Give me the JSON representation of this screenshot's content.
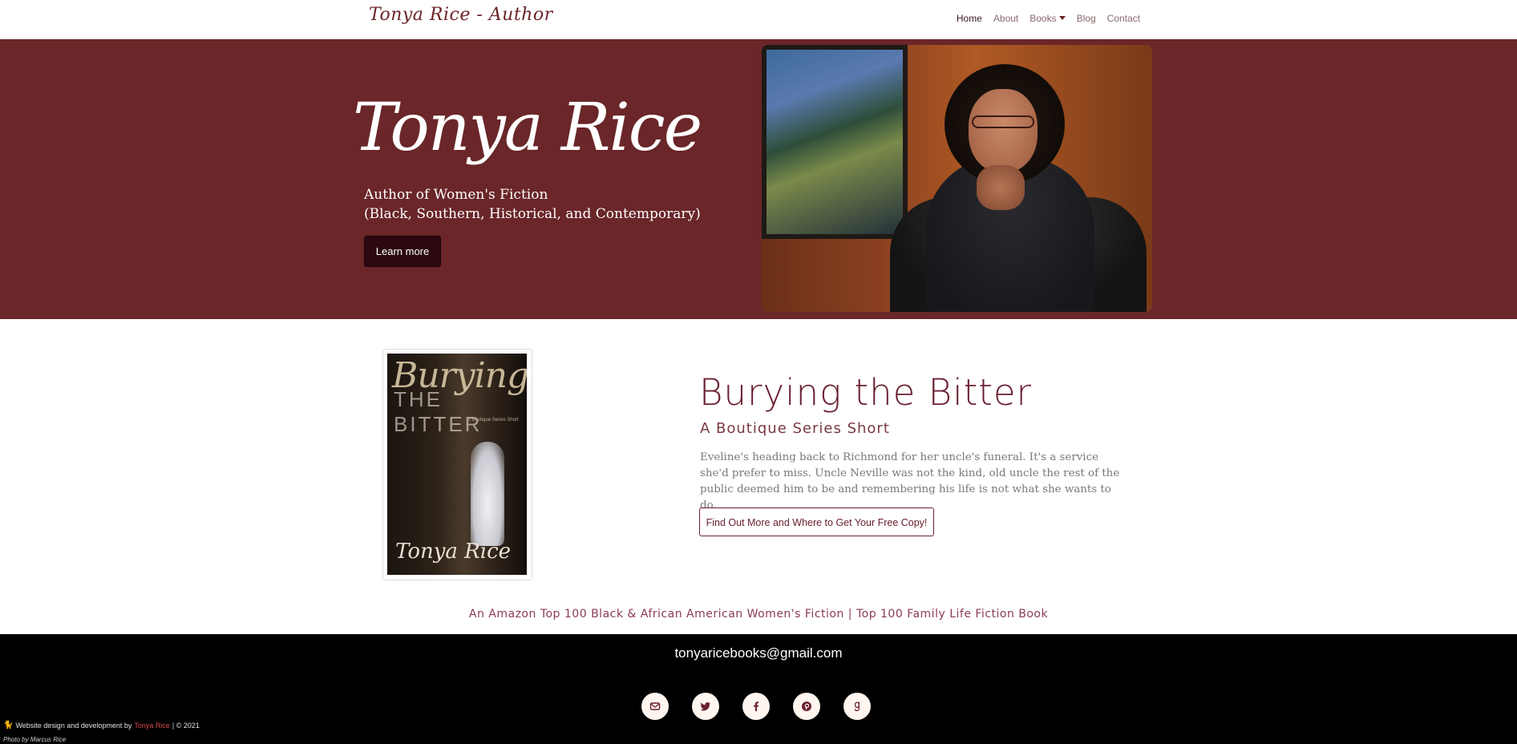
{
  "nav": {
    "brand": "Tonya Rice - Author",
    "items": [
      {
        "label": "Home",
        "active": true
      },
      {
        "label": "About"
      },
      {
        "label": "Books",
        "dropdown": true
      },
      {
        "label": "Blog"
      },
      {
        "label": "Contact"
      }
    ]
  },
  "hero": {
    "title": "Tonya Rice",
    "subtitle_line1": "Author of Women's Fiction",
    "subtitle_line2": "(Black, Southern, Historical, and Contemporary)",
    "button_label": "Learn more"
  },
  "featured_book": {
    "cover_title": "Burying",
    "cover_subtitle": "THE BITTER",
    "cover_tagline": "A Boutique Series Short",
    "cover_author": "Tonya Rice",
    "title": "Burying the Bitter",
    "subtitle": "A Boutique Series Short",
    "description": "Eveline's heading back to Richmond for her uncle's funeral. It's a service she'd prefer to miss. Uncle Neville was not the kind, old uncle the rest of the public deemed him to be and remembering his life is not what she wants to do.",
    "button_label": "Find Out More and Where to Get Your Free Copy!"
  },
  "tagline": "An Amazon Top 100 Black & African American Women's Fiction | Top 100 Family Life Fiction Book",
  "footer": {
    "email": "tonyaricebooks@gmail.com",
    "socials": [
      "email-icon",
      "twitter-icon",
      "facebook-icon",
      "pinterest-icon",
      "goodreads-icon"
    ],
    "credit_prefix": "Website design and development by",
    "credit_name": "Tonya Rice",
    "credit_suffix": "| © 2021",
    "photo_credit": "Photo by Marcus Rice"
  },
  "colors": {
    "hero_bg": "#6a2629",
    "accent": "#6a2030",
    "footer_bg": "#000000"
  }
}
